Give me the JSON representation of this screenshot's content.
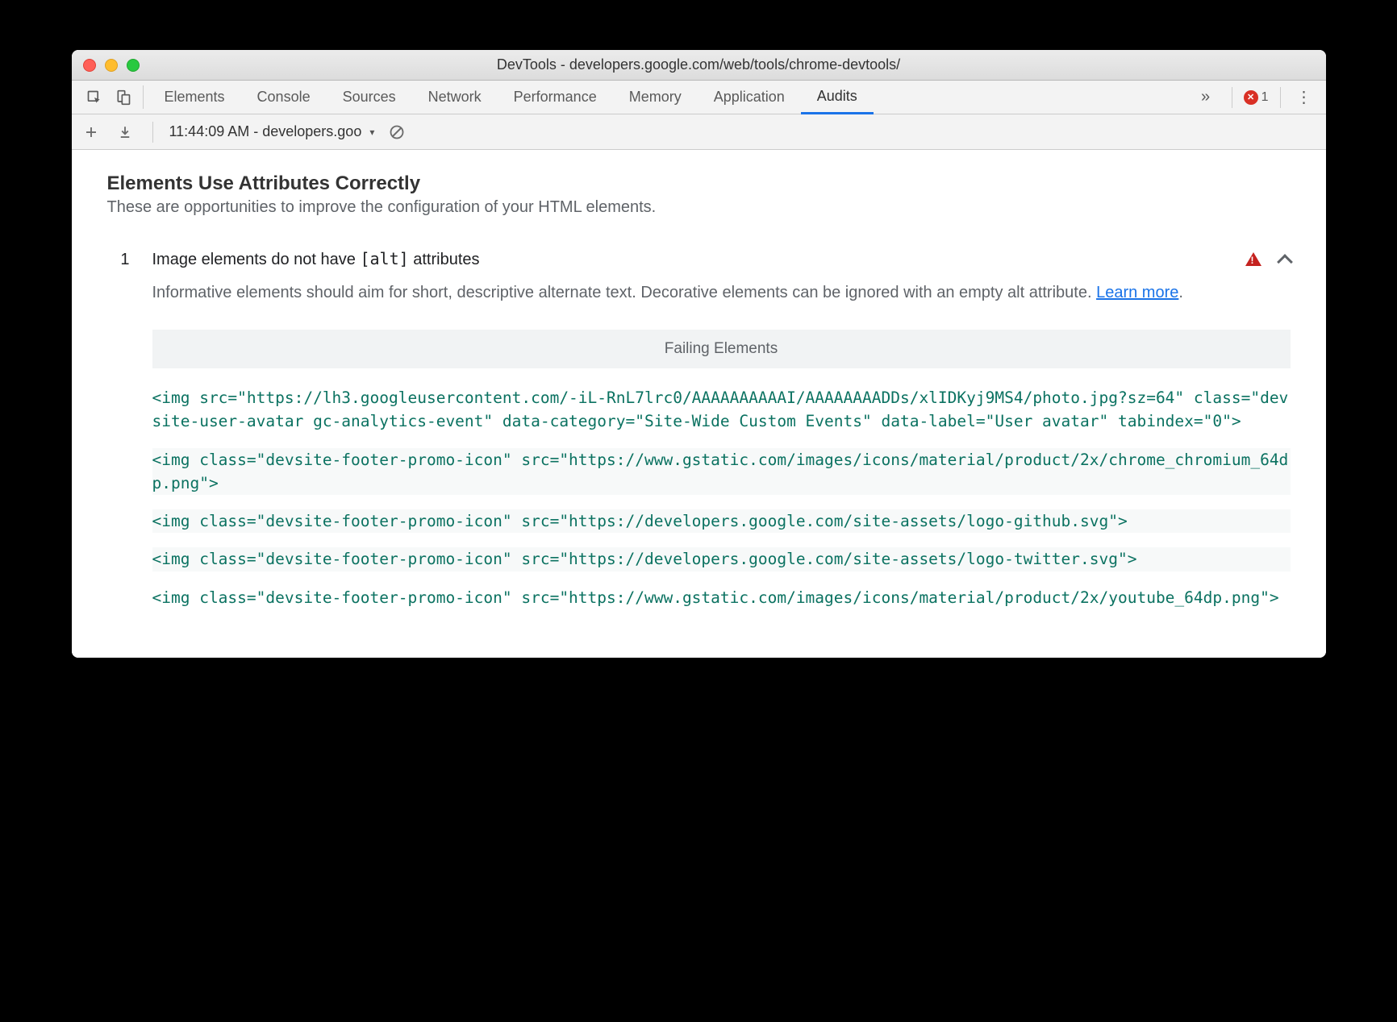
{
  "window": {
    "title": "DevTools - developers.google.com/web/tools/chrome-devtools/"
  },
  "tabs": {
    "items": [
      "Elements",
      "Console",
      "Sources",
      "Network",
      "Performance",
      "Memory",
      "Application",
      "Audits"
    ],
    "active": "Audits",
    "errors": "1"
  },
  "subbar": {
    "selector": "11:44:09 AM - developers.goo"
  },
  "section": {
    "title": "Elements Use Attributes Correctly",
    "subtitle": "These are opportunities to improve the configuration of your HTML elements."
  },
  "audit": {
    "index": "1",
    "title_pre": "Image elements do not have ",
    "title_code": "[alt]",
    "title_post": " attributes",
    "desc_pre": "Informative elements should aim for short, descriptive alternate text. Decorative elements can be ignored with an empty alt attribute. ",
    "learn_more": "Learn more",
    "desc_post": ".",
    "failing_header": "Failing Elements",
    "items": [
      "<img src=\"https://lh3.googleusercontent.com/-iL-RnL7lrc0/AAAAAAAAAAI/AAAAAAAADDs/xlIDKyj9MS4/photo.jpg?sz=64\" class=\"devsite-user-avatar gc-analytics-event\" data-category=\"Site-Wide Custom Events\" data-label=\"User avatar\" tabindex=\"0\">",
      "<img class=\"devsite-footer-promo-icon\" src=\"https://www.gstatic.com/images/icons/material/product/2x/chrome_chromium_64dp.png\">",
      "<img class=\"devsite-footer-promo-icon\" src=\"https://developers.google.com/site-assets/logo-github.svg\">",
      "<img class=\"devsite-footer-promo-icon\" src=\"https://developers.google.com/site-assets/logo-twitter.svg\">",
      "<img class=\"devsite-footer-promo-icon\" src=\"https://www.gstatic.com/images/icons/material/product/2x/youtube_64dp.png\">"
    ]
  }
}
